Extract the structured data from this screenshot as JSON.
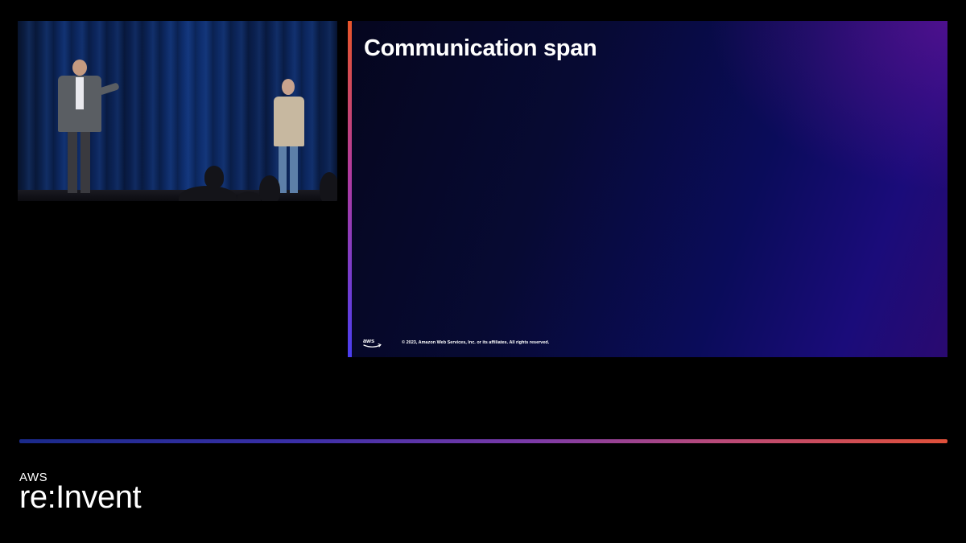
{
  "slide": {
    "title": "Communication span",
    "copyright": "© 2023, Amazon Web Services, Inc. or its affiliates. All rights reserved.",
    "logo_text": "aws"
  },
  "event_logo": {
    "brand": "AWS",
    "name": "re:Invent"
  },
  "colors": {
    "background": "#000000",
    "slide_gradient_start": "#05061e",
    "slide_gradient_end": "#2a0a70",
    "accent_orange": "#e8552a",
    "accent_blue": "#4a3ef0",
    "curtain_blue": "#0f3175"
  }
}
